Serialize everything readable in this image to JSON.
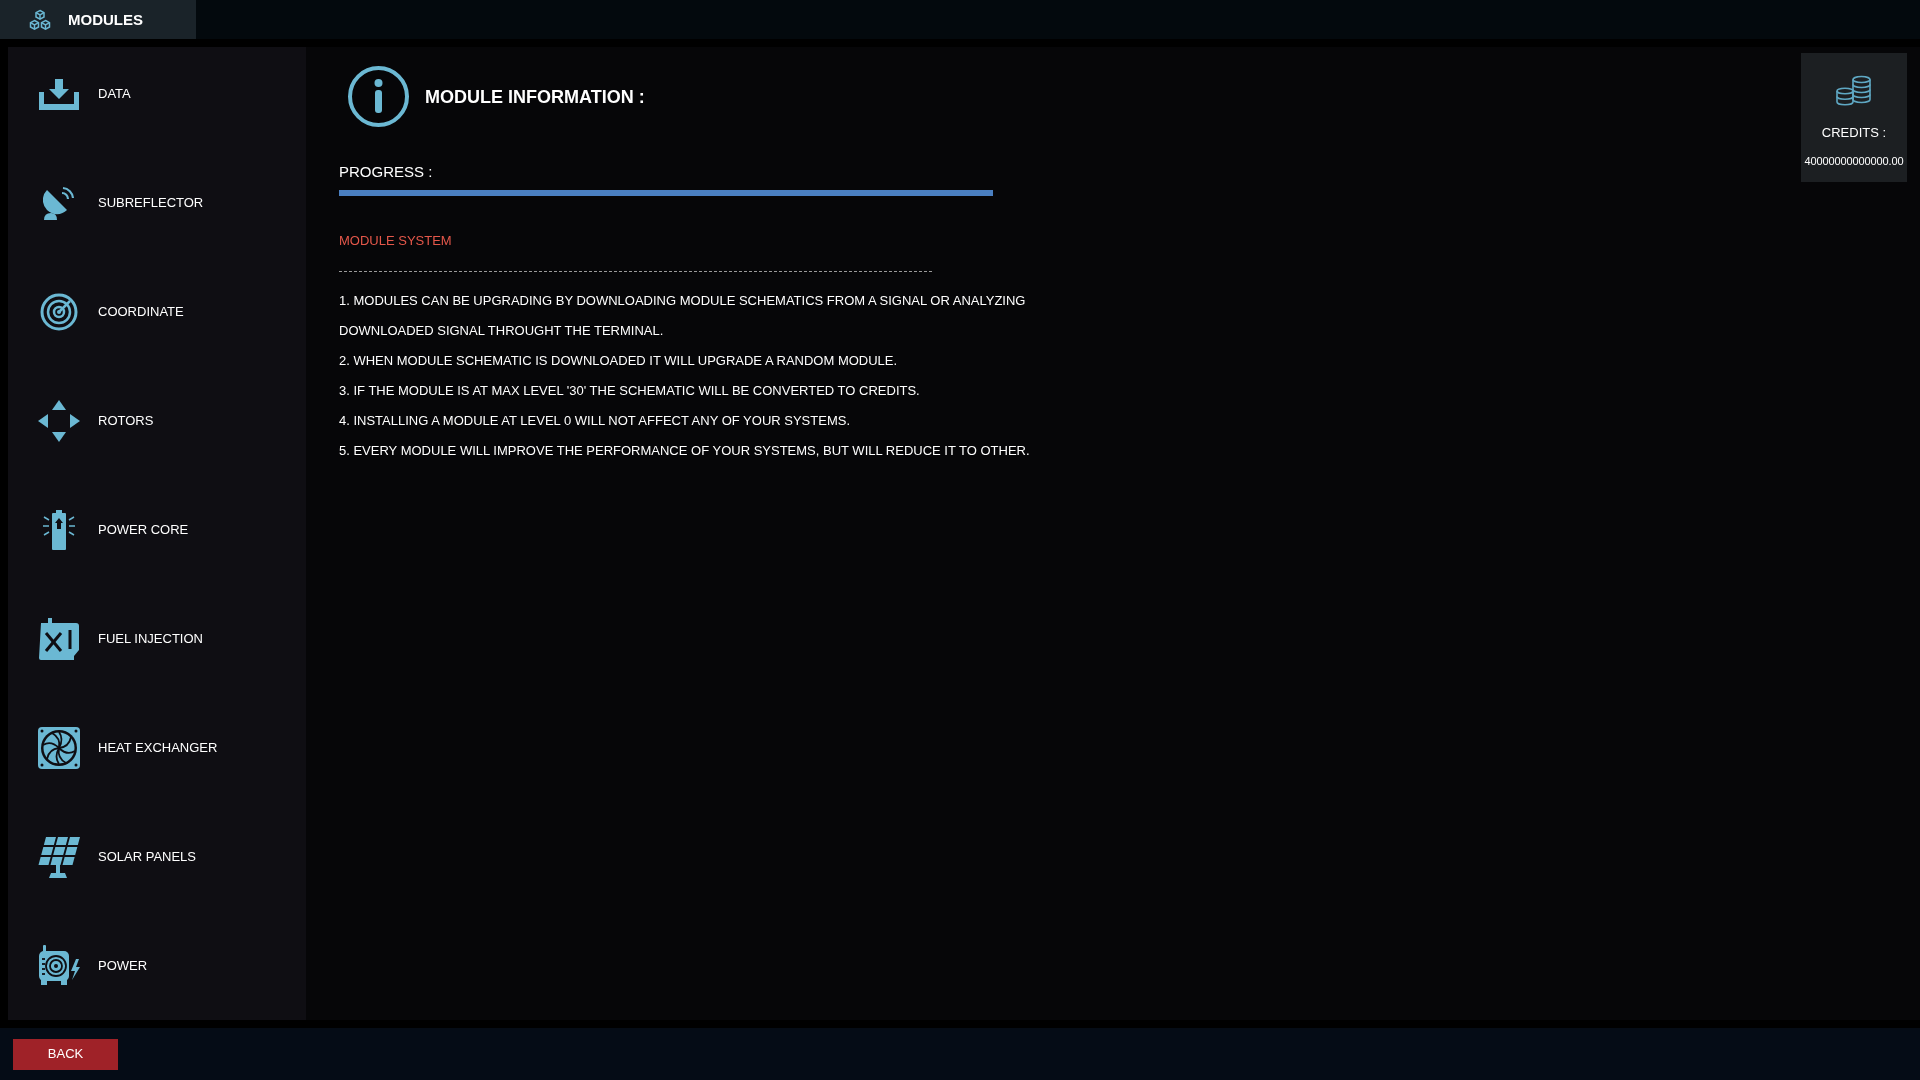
{
  "header": {
    "title": "MODULES"
  },
  "sidebar": {
    "items": [
      {
        "label": "DATA"
      },
      {
        "label": "SUBREFLECTOR"
      },
      {
        "label": "COORDINATE"
      },
      {
        "label": "ROTORS"
      },
      {
        "label": "POWER CORE"
      },
      {
        "label": "FUEL INJECTION"
      },
      {
        "label": "HEAT EXCHANGER"
      },
      {
        "label": "SOLAR PANELS"
      },
      {
        "label": "POWER"
      }
    ]
  },
  "module_info": {
    "title": "MODULE INFORMATION :",
    "progress": {
      "label": "PROGRESS :",
      "level": 1
    },
    "section_title": "MODULE SYSTEM",
    "rules": [
      "1. MODULES CAN BE UPGRADING BY DOWNLOADING MODULE SCHEMATICS FROM A SIGNAL OR ANALYZING DOWNLOADED SIGNAL THROUGHT THE TERMINAL.",
      "2. WHEN MODULE SCHEMATIC IS DOWNLOADED IT WILL UPGRADE A RANDOM MODULE.",
      "3. IF THE MODULE IS AT MAX LEVEL '30' THE SCHEMATIC WILL BE CONVERTED TO CREDITS.",
      "4. INSTALLING A MODULE AT LEVEL 0 WILL NOT AFFECT ANY OF YOUR SYSTEMS.",
      "5. EVERY MODULE WILL IMPROVE THE PERFORMANCE OF YOUR SYSTEMS, BUT WILL REDUCE IT TO OTHER."
    ]
  },
  "credits": {
    "label": "CREDITS :",
    "value": "40000000000000.00"
  },
  "footer": {
    "back_button": "BACK"
  }
}
